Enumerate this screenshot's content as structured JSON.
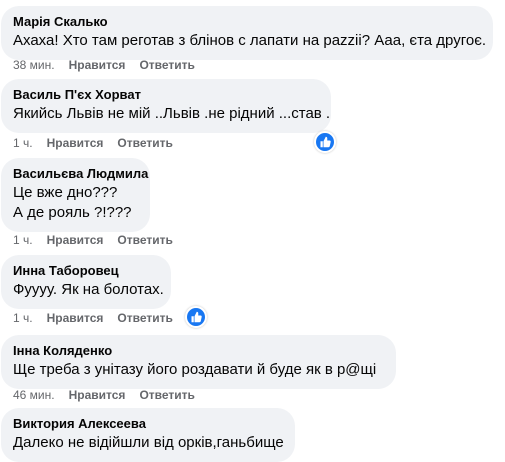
{
  "comments": [
    {
      "author": "Марія Скалько",
      "lines": [
        "Ахаха! Хто там реготав з блінов с лапати на pazzii? Ааа, єта другоє."
      ],
      "time": "38 мин.",
      "like": "Нравится",
      "reply": "Ответить",
      "reaction": null
    },
    {
      "author": "Василь П'єх Хорват",
      "lines": [
        "Якийсь Львів не мій ..Львів .не рідний ...став ."
      ],
      "time": "1 ч.",
      "like": "Нравится",
      "reply": "Ответить",
      "reaction": "like"
    },
    {
      "author": "Васильєва Людмила",
      "lines": [
        "Це вже дно???",
        "А де рояль ?!???"
      ],
      "time": "1 ч.",
      "like": "Нравится",
      "reply": "Ответить",
      "reaction": null
    },
    {
      "author": "Инна Таборовец",
      "lines": [
        "Фуууу. Як на болотах."
      ],
      "time": "1 ч.",
      "like": "Нравится",
      "reply": "Ответить",
      "reaction": "like"
    },
    {
      "author": "Інна Коляденко",
      "lines": [
        "Ще треба з унітазу його роздавати й буде як в р@щі"
      ],
      "time": "46 мин.",
      "like": "Нравится",
      "reply": "Ответить",
      "reaction": null
    },
    {
      "author": "Виктория Алексеева",
      "lines": [
        "Далеко не відійшли від орків,ганьбище"
      ],
      "time": "",
      "like": "",
      "reply": "",
      "reaction": null
    }
  ],
  "colors": {
    "bubble": "#f0f2f5",
    "meta": "#65676b",
    "like_blue": "#1877f2"
  }
}
